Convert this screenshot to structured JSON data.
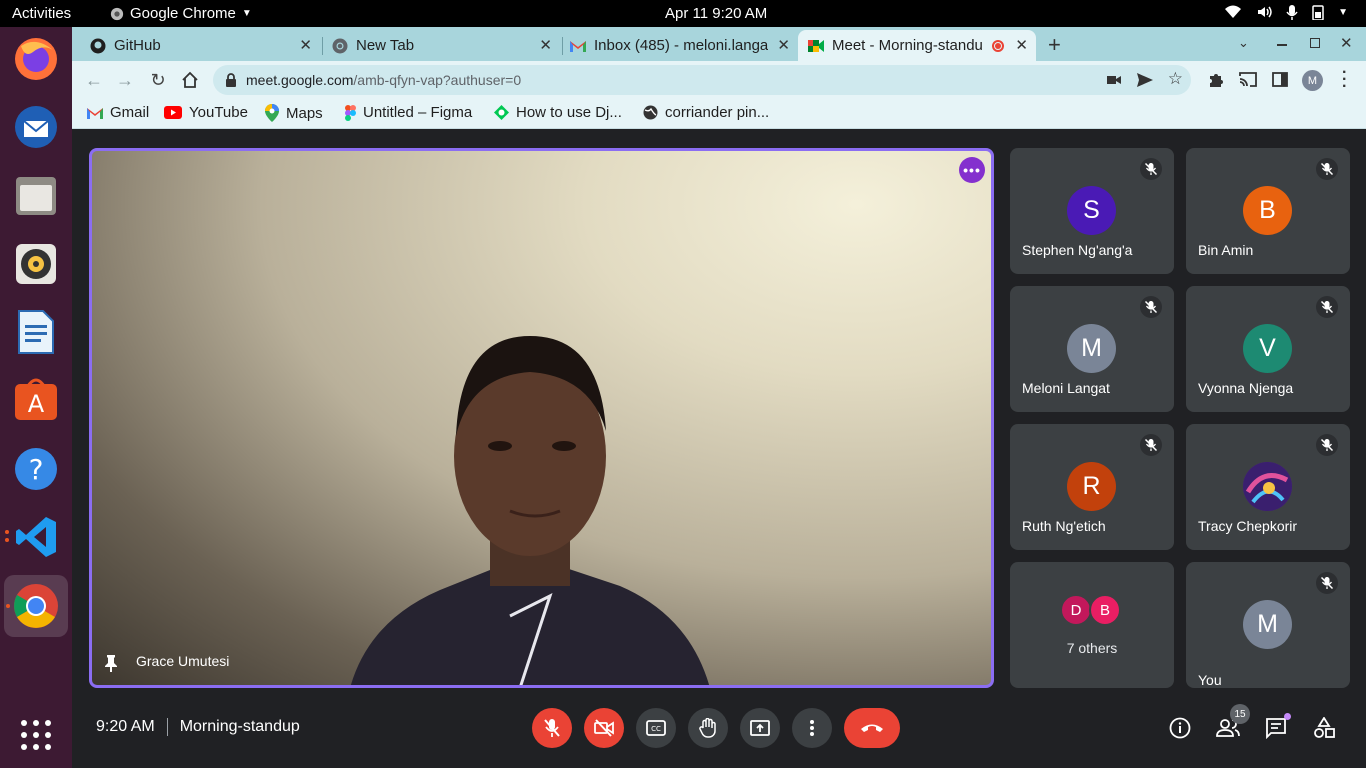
{
  "system": {
    "activities": "Activities",
    "app_name": "Google Chrome",
    "clock": "Apr 11  9:20 AM"
  },
  "dock": {
    "items": [
      "firefox-icon",
      "thunderbird-icon",
      "files-icon",
      "rhythmbox-icon",
      "writer-icon",
      "software-icon",
      "help-icon",
      "vscode-icon",
      "chrome-icon",
      "apps-grid-icon"
    ]
  },
  "tabs": [
    {
      "label": "GitHub",
      "icon": "github-icon"
    },
    {
      "label": "New Tab",
      "icon": "chrome-icon"
    },
    {
      "label": "Inbox (485) - meloni.langa",
      "icon": "gmail-icon"
    },
    {
      "label": "Meet - Morning-standu",
      "icon": "meet-icon",
      "active": true
    }
  ],
  "address": {
    "host": "meet.google.com",
    "path": "/amb-qfyn-vap?authuser=0"
  },
  "bookmarks": [
    {
      "label": "Gmail",
      "icon": "gmail-icon"
    },
    {
      "label": "YouTube",
      "icon": "youtube-icon"
    },
    {
      "label": "Maps",
      "icon": "maps-icon"
    },
    {
      "label": "Untitled – Figma",
      "icon": "figma-icon"
    },
    {
      "label": "How to use Dj...",
      "icon": "bookmark-icon"
    },
    {
      "label": "corriander pin...",
      "icon": "globe-icon"
    }
  ],
  "meet": {
    "main_speaker": "Grace Umutesi",
    "participants": [
      {
        "initial": "S",
        "name": "Stephen Ng'ang'a",
        "color": "#4a1ab5",
        "muted": true
      },
      {
        "initial": "B",
        "name": "Bin Amin",
        "color": "#e8620f",
        "muted": true
      },
      {
        "initial": "M",
        "name": "Meloni Langat",
        "color": "#7a8597",
        "muted": true
      },
      {
        "initial": "V",
        "name": "Vyonna Njenga",
        "color": "#1d8a72",
        "muted": true
      },
      {
        "initial": "R",
        "name": "Ruth Ng'etich",
        "color": "#c2410c",
        "muted": true
      },
      {
        "initial": "",
        "name": "Tracy Chepkorir",
        "color": "#5b2a8a",
        "muted": true
      },
      {
        "name": "You",
        "initial": "M",
        "color": "#7a8597",
        "muted": true
      }
    ],
    "others": {
      "label": "7 others",
      "avatars": [
        {
          "initial": "D",
          "color": "#c2185b"
        },
        {
          "initial": "B",
          "color": "#e91e63"
        }
      ]
    },
    "time": "9:20 AM",
    "meeting_name": "Morning-standup",
    "people_count": "15"
  }
}
